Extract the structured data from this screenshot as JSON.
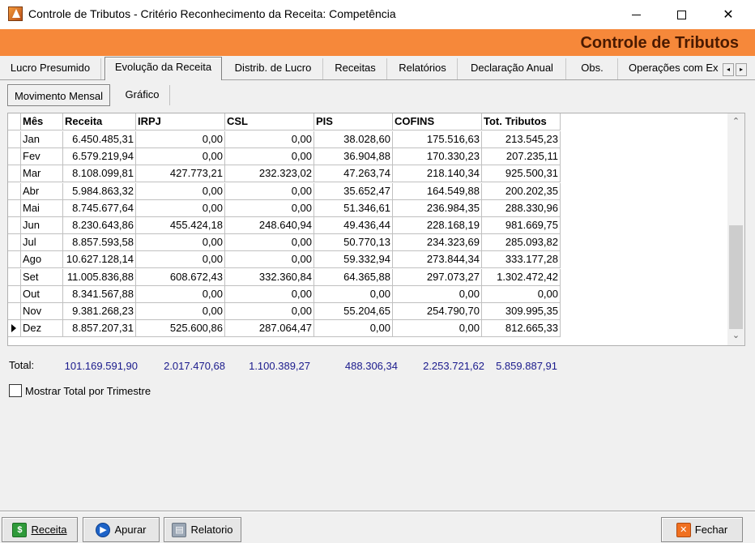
{
  "window": {
    "title": "Controle de Tributos - Critério Reconhecimento da Receita:  Competência",
    "minimize": "—",
    "maximize": "☐",
    "close": "✕"
  },
  "banner": {
    "title": "Controle de Tributos"
  },
  "tabs": [
    {
      "label": "Lucro Presumido"
    },
    {
      "label": "Evolução da Receita"
    },
    {
      "label": "Distrib. de Lucro"
    },
    {
      "label": "Receitas"
    },
    {
      "label": "Relatórios"
    },
    {
      "label": "Declaração Anual"
    },
    {
      "label": "Obs."
    },
    {
      "label": "Operações com Ex"
    }
  ],
  "tab_scroll": {
    "left": "◂",
    "right": "▸"
  },
  "subtabs": [
    {
      "label": "Movimento Mensal"
    },
    {
      "label": "Gráfico"
    }
  ],
  "grid": {
    "columns": [
      "Mês",
      "Receita",
      "IRPJ",
      "CSL",
      "PIS",
      "COFINS",
      "Tot. Tributos"
    ],
    "rows": [
      [
        "Jan",
        "6.450.485,31",
        "0,00",
        "0,00",
        "38.028,60",
        "175.516,63",
        "213.545,23"
      ],
      [
        "Fev",
        "6.579.219,94",
        "0,00",
        "0,00",
        "36.904,88",
        "170.330,23",
        "207.235,11"
      ],
      [
        "Mar",
        "8.108.099,81",
        "427.773,21",
        "232.323,02",
        "47.263,74",
        "218.140,34",
        "925.500,31"
      ],
      [
        "Abr",
        "5.984.863,32",
        "0,00",
        "0,00",
        "35.652,47",
        "164.549,88",
        "200.202,35"
      ],
      [
        "Mai",
        "8.745.677,64",
        "0,00",
        "0,00",
        "51.346,61",
        "236.984,35",
        "288.330,96"
      ],
      [
        "Jun",
        "8.230.643,86",
        "455.424,18",
        "248.640,94",
        "49.436,44",
        "228.168,19",
        "981.669,75"
      ],
      [
        "Jul",
        "8.857.593,58",
        "0,00",
        "0,00",
        "50.770,13",
        "234.323,69",
        "285.093,82"
      ],
      [
        "Ago",
        "10.627.128,14",
        "0,00",
        "0,00",
        "59.332,94",
        "273.844,34",
        "333.177,28"
      ],
      [
        "Set",
        "11.005.836,88",
        "608.672,43",
        "332.360,84",
        "64.365,88",
        "297.073,27",
        "1.302.472,42"
      ],
      [
        "Out",
        "8.341.567,88",
        "0,00",
        "0,00",
        "0,00",
        "0,00",
        "0,00"
      ],
      [
        "Nov",
        "9.381.268,23",
        "0,00",
        "0,00",
        "55.204,65",
        "254.790,70",
        "309.995,35"
      ],
      [
        "Dez",
        "8.857.207,31",
        "525.600,86",
        "287.064,47",
        "0,00",
        "0,00",
        "812.665,33"
      ]
    ],
    "current_row": 11,
    "scroll_up": "⌃",
    "scroll_down": "⌄"
  },
  "totals": {
    "label": "Total:",
    "values": [
      "101.169.591,90",
      "2.017.470,68",
      "1.100.389,27",
      "488.306,34",
      "2.253.721,62",
      "5.859.887,91"
    ]
  },
  "show_quarterly": {
    "label": "Mostrar Total por Trimestre",
    "checked": false
  },
  "buttons": {
    "receita": "Receita",
    "apurar": "Apurar",
    "relatorio": "Relatorio",
    "fechar": "Fechar"
  },
  "colors": {
    "banner": "#f6883a",
    "banner_text": "#4a1a00",
    "totals_text": "#1a1a8c"
  }
}
